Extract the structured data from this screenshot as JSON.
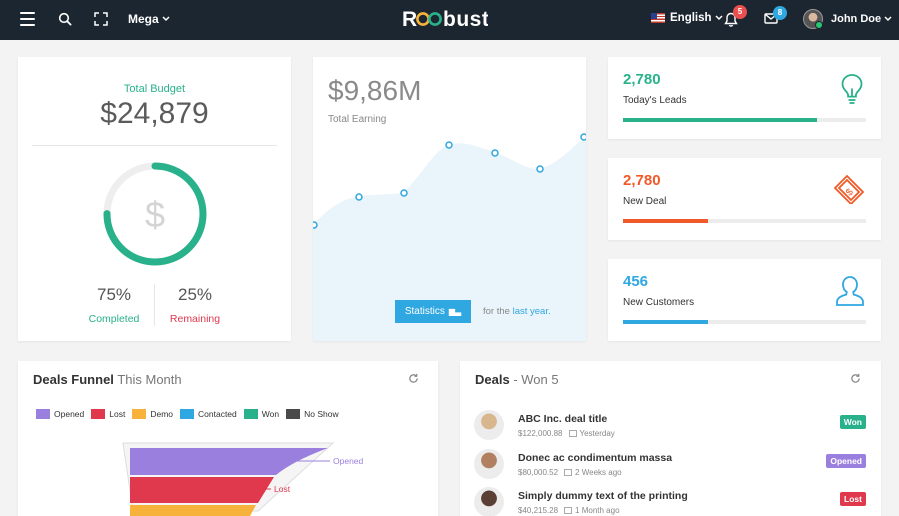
{
  "navbar": {
    "mega_label": "Mega",
    "logo": "Robust",
    "language": "English",
    "notifications_count": "5",
    "messages_count": "8",
    "user_name": "John Doe"
  },
  "budget": {
    "title": "Total Budget",
    "value": "$24,879",
    "progress": 0.75,
    "completed_pct": "75%",
    "completed_label": "Completed",
    "remaining_pct": "25%",
    "remaining_label": "Remaining"
  },
  "earning": {
    "value": "$9,86M",
    "label": "Total Earning",
    "button_label": "Statistics",
    "footnote_prefix": "for the",
    "footnote_highlight": "last year."
  },
  "kpis": [
    {
      "value": "2,780",
      "label": "Today's Leads",
      "color": "#28b18a",
      "progress": 0.8,
      "icon": "lightbulb-icon"
    },
    {
      "value": "2,780",
      "label": "New Deal",
      "color": "#f05a28",
      "progress": 0.35,
      "icon": "money-icon"
    },
    {
      "value": "456",
      "label": "New Customers",
      "color": "#2fa7e0",
      "progress": 0.35,
      "icon": "user-icon"
    }
  ],
  "funnel": {
    "title": "Deals Funnel",
    "subtitle": "This Month",
    "legend": [
      {
        "label": "Opened",
        "color": "#9b7fde"
      },
      {
        "label": "Lost",
        "color": "#e0384c"
      },
      {
        "label": "Demo",
        "color": "#f7b23b"
      },
      {
        "label": "Contacted",
        "color": "#2fa7e0"
      },
      {
        "label": "Won",
        "color": "#28b18a"
      },
      {
        "label": "No Show",
        "color": "#4a4a4a"
      }
    ],
    "annotations": [
      "Opened",
      "Lost"
    ]
  },
  "deals": {
    "title": "Deals",
    "subtitle": "- Won 5",
    "items": [
      {
        "name": "ABC Inc. deal title",
        "amount": "$122,000.88",
        "when": "Yesterday",
        "status": "Won",
        "status_color": "#28b18a",
        "avatar_color": "#d8b78f"
      },
      {
        "name": "Donec ac condimentum massa",
        "amount": "$80,000.52",
        "when": "2 Weeks ago",
        "status": "Opened",
        "status_color": "#9b7fde",
        "avatar_color": "#b08060"
      },
      {
        "name": "Simply dummy text of the printing",
        "amount": "$40,215.28",
        "when": "1 Month ago",
        "status": "Lost",
        "status_color": "#e0384c",
        "avatar_color": "#5a4034"
      }
    ]
  },
  "colors": {
    "navbar_bg": "#1c2630",
    "green": "#28b18a",
    "red": "#e0384c",
    "blue": "#2fa7e0"
  }
}
